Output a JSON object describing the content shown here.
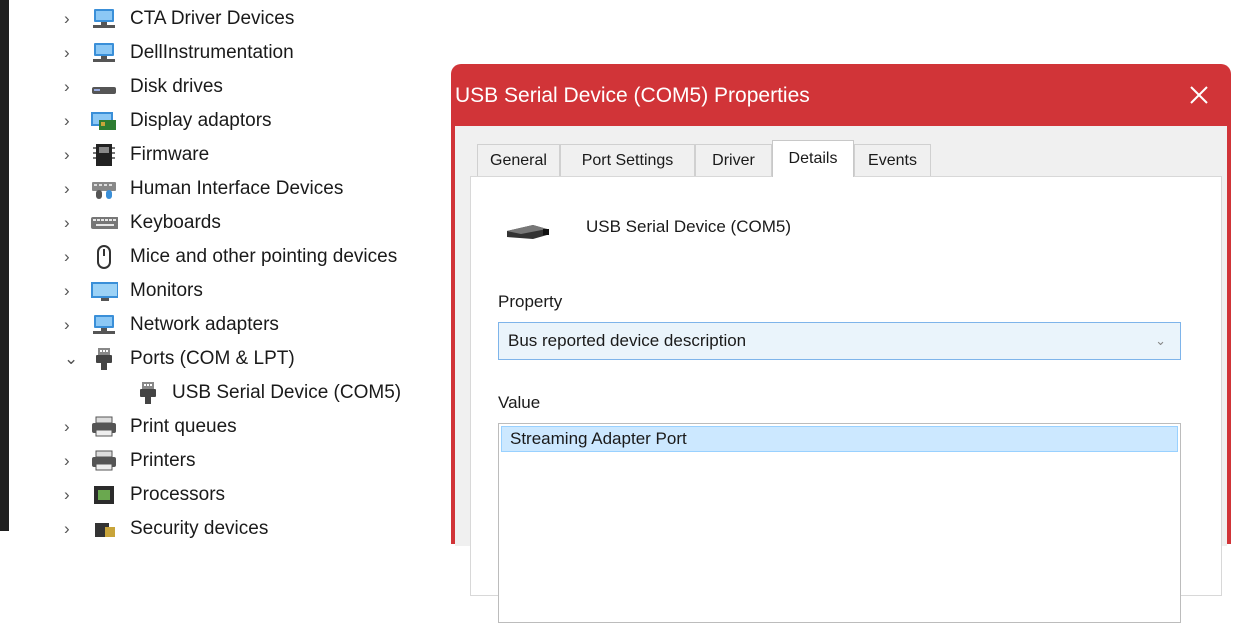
{
  "tree": {
    "items": [
      {
        "label": "CTA Driver Devices",
        "expanded": false,
        "icon": "monitor-network-icon"
      },
      {
        "label": "DellInstrumentation",
        "expanded": false,
        "icon": "monitor-network-icon"
      },
      {
        "label": "Disk drives",
        "expanded": false,
        "icon": "disk-drive-icon"
      },
      {
        "label": "Display adaptors",
        "expanded": false,
        "icon": "display-adapter-icon"
      },
      {
        "label": "Firmware",
        "expanded": false,
        "icon": "firmware-chip-icon"
      },
      {
        "label": "Human Interface Devices",
        "expanded": false,
        "icon": "hid-icon"
      },
      {
        "label": "Keyboards",
        "expanded": false,
        "icon": "keyboard-icon"
      },
      {
        "label": "Mice and other pointing devices",
        "expanded": false,
        "icon": "mouse-icon"
      },
      {
        "label": "Monitors",
        "expanded": false,
        "icon": "monitor-icon"
      },
      {
        "label": "Network adapters",
        "expanded": false,
        "icon": "monitor-network-icon"
      },
      {
        "label": "Ports (COM & LPT)",
        "expanded": true,
        "icon": "port-icon"
      },
      {
        "label": "USB Serial Device (COM5)",
        "child": true,
        "icon": "port-icon"
      },
      {
        "label": "Print queues",
        "expanded": false,
        "icon": "printer-icon"
      },
      {
        "label": "Printers",
        "expanded": false,
        "icon": "printer-icon"
      },
      {
        "label": "Processors",
        "expanded": false,
        "icon": "processor-icon"
      },
      {
        "label": "Security devices",
        "expanded": false,
        "icon": "security-icon"
      }
    ]
  },
  "dialog": {
    "title": "USB Serial Device (COM5) Properties",
    "accent": "#d13438",
    "tabs": [
      "General",
      "Port Settings",
      "Driver",
      "Details",
      "Events"
    ],
    "active_tab": "Details",
    "device_name": "USB Serial Device (COM5)",
    "property_label": "Property",
    "property_selected": "Bus reported device description",
    "value_label": "Value",
    "value_items": [
      "Streaming Adapter Port"
    ]
  }
}
